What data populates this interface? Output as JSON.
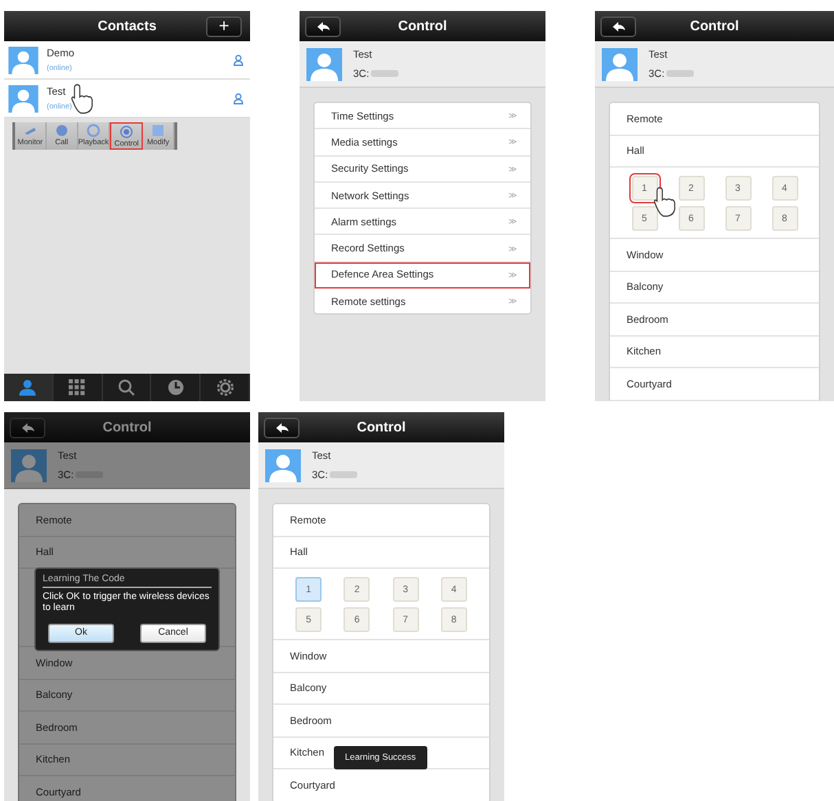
{
  "rows": [
    [
      {
        "kind": "contacts",
        "title": "Contacts",
        "add_button": "+",
        "contacts": [
          {
            "name": "Demo",
            "status": "(online)",
            "touched": false
          },
          {
            "name": "Test",
            "status": "(online)",
            "touched": true
          }
        ],
        "actions": [
          {
            "label": "Monitor",
            "highlighted": false
          },
          {
            "label": "Call",
            "highlighted": false
          },
          {
            "label": "Playback",
            "highlighted": false
          },
          {
            "label": "Control",
            "highlighted": true
          },
          {
            "label": "Modify",
            "highlighted": false
          }
        ],
        "tab_bar": [
          {
            "kind": "contacts",
            "selected": true
          },
          {
            "kind": "keypad",
            "selected": false
          },
          {
            "kind": "search",
            "selected": false
          },
          {
            "kind": "history",
            "selected": false
          },
          {
            "kind": "settings",
            "selected": false
          }
        ]
      },
      {
        "kind": "menu",
        "title": "Control",
        "device": {
          "name": "Test",
          "id": "3C:"
        },
        "items": [
          {
            "label": "Time Settings",
            "arrow": "≫",
            "highlighted": false
          },
          {
            "label": "Media settings",
            "arrow": "≫",
            "highlighted": false
          },
          {
            "label": "Security Settings",
            "arrow": "≫",
            "highlighted": false
          },
          {
            "label": "Network Settings",
            "arrow": "≫",
            "highlighted": false
          },
          {
            "label": "Alarm settings",
            "arrow": "≫",
            "highlighted": false
          },
          {
            "label": "Record Settings",
            "arrow": "≫",
            "highlighted": false
          },
          {
            "label": "Defence Area Settings",
            "arrow": "≫",
            "highlighted": true
          },
          {
            "label": "Remote settings",
            "arrow": "≫",
            "highlighted": false
          }
        ]
      },
      {
        "kind": "zones",
        "title": "Control",
        "device": {
          "name": "Test",
          "id": "3C:"
        },
        "rows": [
          {
            "kind": "area",
            "label": "Remote"
          },
          {
            "kind": "area",
            "label": "Hall"
          },
          {
            "kind": "zones",
            "zones": [
              {
                "label": "1",
                "selected": false,
                "highlighted": true,
                "touched": true
              },
              {
                "label": "2",
                "selected": false,
                "highlighted": false,
                "touched": false
              },
              {
                "label": "3",
                "selected": false,
                "highlighted": false,
                "touched": false
              },
              {
                "label": "4",
                "selected": false,
                "highlighted": false,
                "touched": false
              },
              {
                "label": "5",
                "selected": false,
                "highlighted": false,
                "touched": false
              },
              {
                "label": "6",
                "selected": false,
                "highlighted": false,
                "touched": false
              },
              {
                "label": "7",
                "selected": false,
                "highlighted": false,
                "touched": false
              },
              {
                "label": "8",
                "selected": false,
                "highlighted": false,
                "touched": false
              }
            ]
          },
          {
            "kind": "area",
            "label": "Window"
          },
          {
            "kind": "area",
            "label": "Balcony"
          },
          {
            "kind": "area",
            "label": "Bedroom"
          },
          {
            "kind": "area",
            "label": "Kitchen"
          },
          {
            "kind": "area",
            "label": "Courtyard"
          }
        ]
      }
    ],
    [
      {
        "kind": "zones",
        "title": "Control",
        "device": {
          "name": "Test",
          "id": "3C:"
        },
        "rows": [
          {
            "kind": "area",
            "label": "Remote"
          },
          {
            "kind": "area",
            "label": "Hall"
          },
          {
            "kind": "covered"
          },
          {
            "kind": "area",
            "label": "Window"
          },
          {
            "kind": "area",
            "label": "Balcony"
          },
          {
            "kind": "area",
            "label": "Bedroom"
          },
          {
            "kind": "area",
            "label": "Kitchen"
          },
          {
            "kind": "area",
            "label": "Courtyard"
          }
        ],
        "dialog": {
          "title": "Learning The Code",
          "message": "Click OK to trigger the wireless devices to learn",
          "buttons": [
            {
              "label": "Ok",
              "selected": true
            },
            {
              "label": "Cancel",
              "selected": false
            }
          ]
        }
      },
      {
        "kind": "zones",
        "title": "Control",
        "device": {
          "name": "Test",
          "id": "3C:"
        },
        "rows": [
          {
            "kind": "area",
            "label": "Remote"
          },
          {
            "kind": "area",
            "label": "Hall"
          },
          {
            "kind": "zones",
            "zones": [
              {
                "label": "1",
                "selected": true,
                "highlighted": false,
                "touched": false
              },
              {
                "label": "2",
                "selected": false,
                "highlighted": false,
                "touched": false
              },
              {
                "label": "3",
                "selected": false,
                "highlighted": false,
                "touched": false
              },
              {
                "label": "4",
                "selected": false,
                "highlighted": false,
                "touched": false
              },
              {
                "label": "5",
                "selected": false,
                "highlighted": false,
                "touched": false
              },
              {
                "label": "6",
                "selected": false,
                "highlighted": false,
                "touched": false
              },
              {
                "label": "7",
                "selected": false,
                "highlighted": false,
                "touched": false
              },
              {
                "label": "8",
                "selected": false,
                "highlighted": false,
                "touched": false
              }
            ]
          },
          {
            "kind": "area",
            "label": "Window"
          },
          {
            "kind": "area",
            "label": "Balcony"
          },
          {
            "kind": "area",
            "label": "Bedroom"
          },
          {
            "kind": "area",
            "label": "Kitchen"
          },
          {
            "kind": "area",
            "label": "Courtyard"
          }
        ],
        "toast": "Learning Success"
      }
    ]
  ]
}
